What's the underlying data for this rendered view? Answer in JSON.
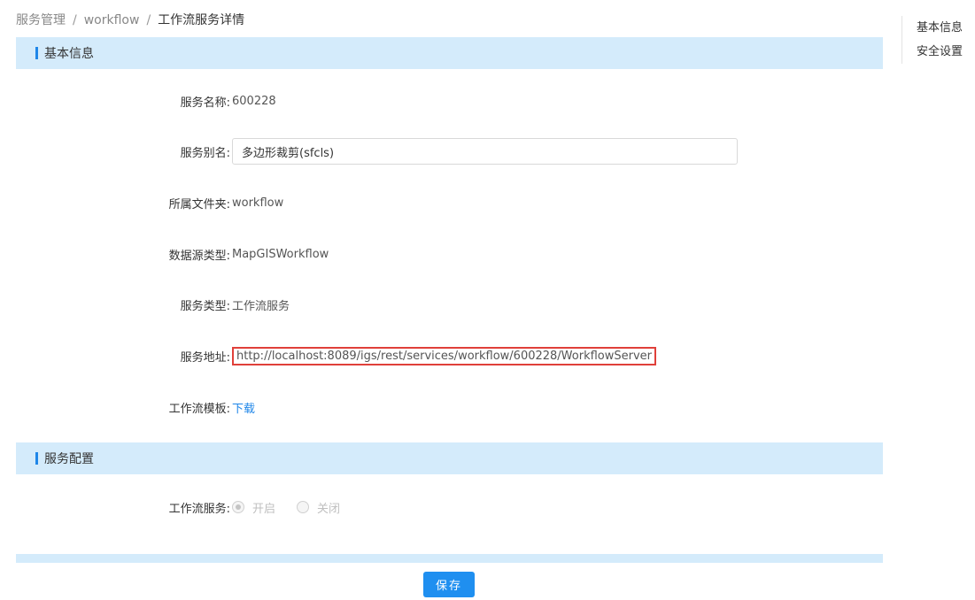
{
  "breadcrumb": [
    {
      "label": "服务管理"
    },
    {
      "label": "workflow"
    },
    {
      "label": "工作流服务详情"
    }
  ],
  "breadcrumb_separator": "/",
  "sections": {
    "basic": {
      "title": "基本信息"
    },
    "config": {
      "title": "服务配置"
    }
  },
  "fields": {
    "name": {
      "label": "服务名称:",
      "value": "600228"
    },
    "alias": {
      "label": "服务别名:",
      "value": "多边形裁剪(sfcls)"
    },
    "folder": {
      "label": "所属文件夹:",
      "value": "workflow"
    },
    "datasource": {
      "label": "数据源类型:",
      "value": "MapGISWorkflow"
    },
    "type": {
      "label": "服务类型:",
      "value": "工作流服务"
    },
    "url": {
      "label": "服务地址:",
      "value": "http://localhost:8089/igs/rest/services/workflow/600228/WorkflowServer"
    },
    "template": {
      "label": "工作流模板:",
      "link": "下载"
    }
  },
  "workflow_service": {
    "label": "工作流服务:",
    "options": [
      {
        "label": "开启",
        "checked": true
      },
      {
        "label": "关闭",
        "checked": false
      }
    ],
    "disabled": true
  },
  "actions": {
    "save_label": "保存"
  },
  "anchor_nav": [
    {
      "label": "基本信息"
    },
    {
      "label": "安全设置"
    }
  ],
  "colors": {
    "accent": "#1f86e8",
    "section_bg": "#d4ebfb",
    "highlight_border": "#e0403a",
    "button": "#1f8ff0"
  }
}
